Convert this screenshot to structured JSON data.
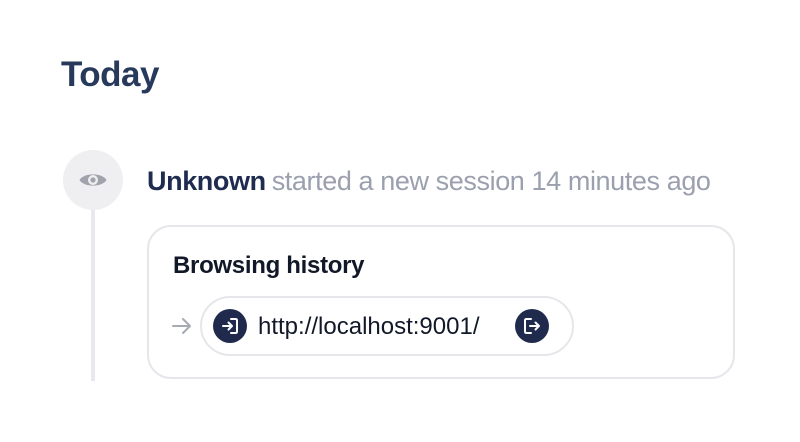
{
  "section": {
    "heading": "Today"
  },
  "event": {
    "actor": "Unknown",
    "action": "started a new session 14 minutes ago",
    "avatar_icon": "eye-icon"
  },
  "card": {
    "title": "Browsing history",
    "arrow_icon": "arrow-right-icon",
    "entries": [
      {
        "url": "http://localhost:9001/",
        "enter_icon": "enter-icon",
        "exit_icon": "exit-icon"
      }
    ]
  },
  "colors": {
    "heading": "#273a5b",
    "actor": "#1f2b4f",
    "muted": "#9aa0ae",
    "icon_bg": "#1f2a4d",
    "border": "#e6e7eb"
  }
}
